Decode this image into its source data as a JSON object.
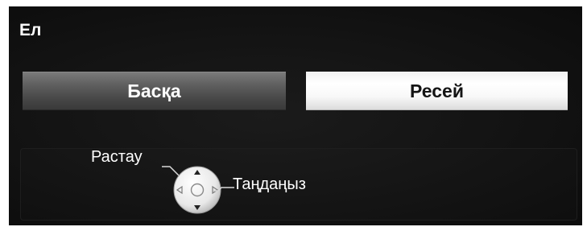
{
  "screen": {
    "title": "Ел"
  },
  "options": [
    {
      "label": "Басқа",
      "selected": false
    },
    {
      "label": "Ресей",
      "selected": true
    }
  ],
  "hints": {
    "confirm_label": "Растау",
    "select_label": "Таңдаңыз"
  },
  "colors": {
    "background": "#131313",
    "selected_option_bg": "#f8f8f8",
    "unselected_option_bg": "#5e5e5e",
    "text": "#ffffff"
  },
  "icons": {
    "dpad": "remote-dpad-icon"
  }
}
